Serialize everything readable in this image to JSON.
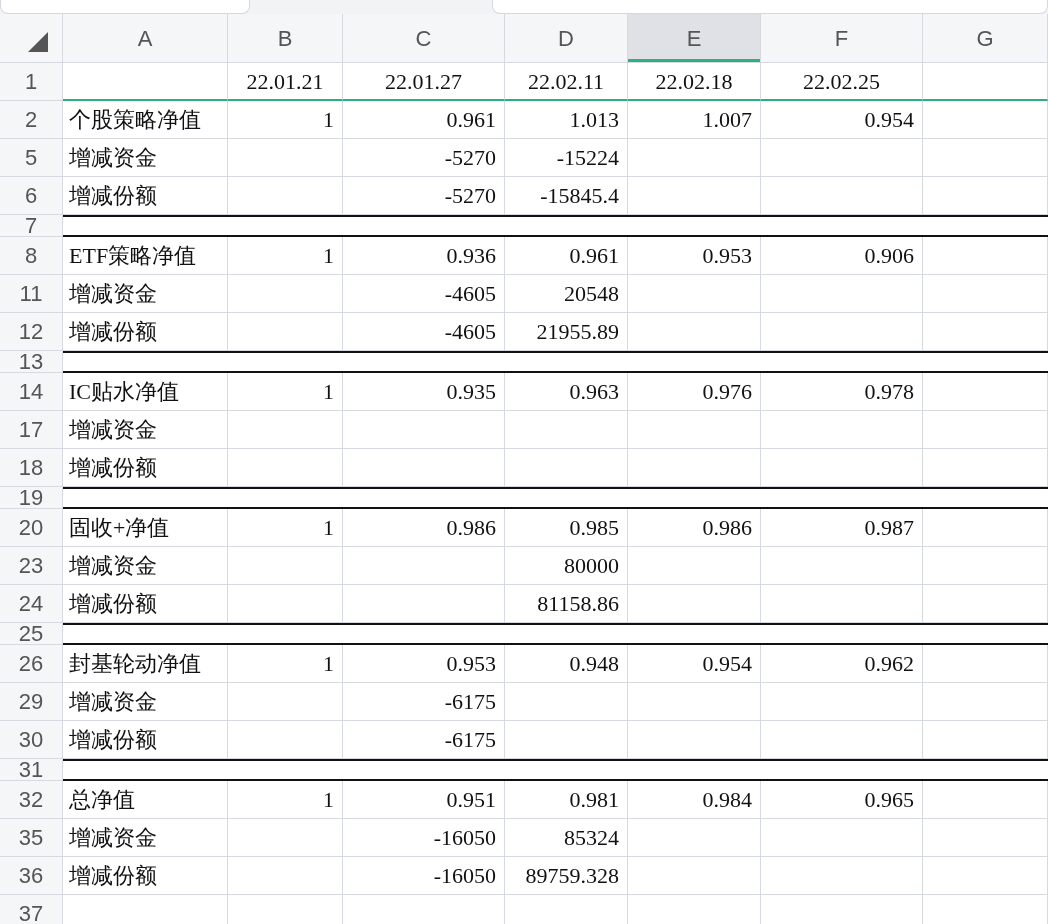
{
  "columns": [
    {
      "label": "A",
      "selected": false
    },
    {
      "label": "B",
      "selected": false
    },
    {
      "label": "C",
      "selected": false
    },
    {
      "label": "D",
      "selected": false
    },
    {
      "label": "E",
      "selected": true
    },
    {
      "label": "F",
      "selected": false
    },
    {
      "label": "G",
      "selected": false
    }
  ],
  "rows": [
    {
      "label": "1",
      "kind": "frozen",
      "cells": {
        "B": "22.01.21",
        "C": "22.01.27",
        "D": "22.02.11",
        "E": "22.02.18",
        "F": "22.02.25"
      }
    },
    {
      "label": "2",
      "kind": "data",
      "cells": {
        "A": "个股策略净值",
        "B": "1",
        "C": "0.961",
        "D": "1.013",
        "E": "1.007",
        "F": "0.954"
      }
    },
    {
      "label": "5",
      "kind": "data",
      "cells": {
        "A": "增减资金",
        "C": "-5270",
        "D": "-15224"
      }
    },
    {
      "label": "6",
      "kind": "data",
      "cells": {
        "A": "增减份额",
        "C": "-5270",
        "D": "-15845.4"
      }
    },
    {
      "label": "7",
      "kind": "spacer",
      "cells": {}
    },
    {
      "label": "8",
      "kind": "data",
      "cells": {
        "A": "ETF策略净值",
        "B": "1",
        "C": "0.936",
        "D": "0.961",
        "E": "0.953",
        "F": "0.906"
      }
    },
    {
      "label": "11",
      "kind": "data",
      "cells": {
        "A": "增减资金",
        "C": "-4605",
        "D": "20548"
      }
    },
    {
      "label": "12",
      "kind": "data",
      "cells": {
        "A": "增减份额",
        "C": "-4605",
        "D": "21955.89"
      }
    },
    {
      "label": "13",
      "kind": "spacer",
      "cells": {}
    },
    {
      "label": "14",
      "kind": "data",
      "cells": {
        "A": "IC贴水净值",
        "B": "1",
        "C": "0.935",
        "D": "0.963",
        "E": "0.976",
        "F": "0.978"
      }
    },
    {
      "label": "17",
      "kind": "data",
      "cells": {
        "A": "增减资金"
      }
    },
    {
      "label": "18",
      "kind": "data",
      "cells": {
        "A": "增减份额"
      }
    },
    {
      "label": "19",
      "kind": "spacer",
      "cells": {}
    },
    {
      "label": "20",
      "kind": "data",
      "cells": {
        "A": "固收+净值",
        "B": "1",
        "C": "0.986",
        "D": "0.985",
        "E": "0.986",
        "F": "0.987"
      }
    },
    {
      "label": "23",
      "kind": "data",
      "cells": {
        "A": "增减资金",
        "D": "80000"
      }
    },
    {
      "label": "24",
      "kind": "data",
      "cells": {
        "A": "增减份额",
        "D": "81158.86"
      }
    },
    {
      "label": "25",
      "kind": "spacer",
      "cells": {}
    },
    {
      "label": "26",
      "kind": "data",
      "cells": {
        "A": "封基轮动净值",
        "B": "1",
        "C": "0.953",
        "D": "0.948",
        "E": "0.954",
        "F": "0.962"
      }
    },
    {
      "label": "29",
      "kind": "data",
      "cells": {
        "A": "增减资金",
        "C": "-6175"
      }
    },
    {
      "label": "30",
      "kind": "data",
      "cells": {
        "A": "增减份额",
        "C": "-6175"
      }
    },
    {
      "label": "31",
      "kind": "spacer",
      "cells": {}
    },
    {
      "label": "32",
      "kind": "data",
      "cells": {
        "A": "总净值",
        "B": "1",
        "C": "0.951",
        "D": "0.981",
        "E": "0.984",
        "F": "0.965"
      }
    },
    {
      "label": "35",
      "kind": "data",
      "cells": {
        "A": "增减资金",
        "C": "-16050",
        "D": "85324"
      }
    },
    {
      "label": "36",
      "kind": "data",
      "cells": {
        "A": "增减份额",
        "C": "-16050",
        "D": "89759.328"
      }
    },
    {
      "label": "37",
      "kind": "data",
      "cells": {}
    }
  ]
}
